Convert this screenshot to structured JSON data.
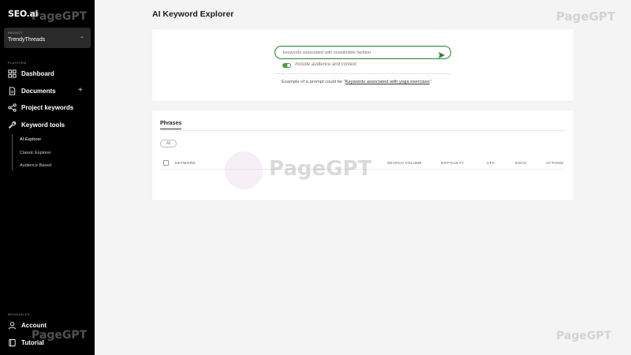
{
  "brand": {
    "logo": "SEO.ai"
  },
  "sidebar": {
    "project_label": "PROJECT",
    "project_value": "TrendyThreads",
    "platform_label": "PLATFORM",
    "items": [
      {
        "label": "Dashboard",
        "icon": "grid-icon"
      },
      {
        "label": "Documents",
        "icon": "document-icon"
      },
      {
        "label": "Project keywords",
        "icon": "share-icon"
      },
      {
        "label": "Keyword tools",
        "icon": "wrench-icon"
      }
    ],
    "subitems": [
      "AI Explorer",
      "Classic Explorer",
      "Audience Based"
    ],
    "resources_label": "RESOURCES",
    "resources": [
      {
        "label": "Account",
        "icon": "user-icon"
      },
      {
        "label": "Tutorial",
        "icon": "book-icon"
      }
    ]
  },
  "main": {
    "title": "AI Keyword Explorer",
    "search_placeholder": "keywords associated with sustainable fashion",
    "toggle_label": "Include audience and context",
    "toggle_on": true,
    "example_prefix": "Example of a prompt could be \"",
    "example_link": "Keywords associated with yoga exercises",
    "example_suffix": "\"",
    "tab": "Phrases",
    "filter_all": "All",
    "columns": [
      "KEYWORD",
      "SEARCH VOLUME",
      "DIFFICULTY",
      "CPC",
      "DOCS",
      "ACTIONS"
    ]
  },
  "watermark": "PageGPT",
  "colors": {
    "accent": "#43a047",
    "sidebar_bg": "#000000"
  }
}
